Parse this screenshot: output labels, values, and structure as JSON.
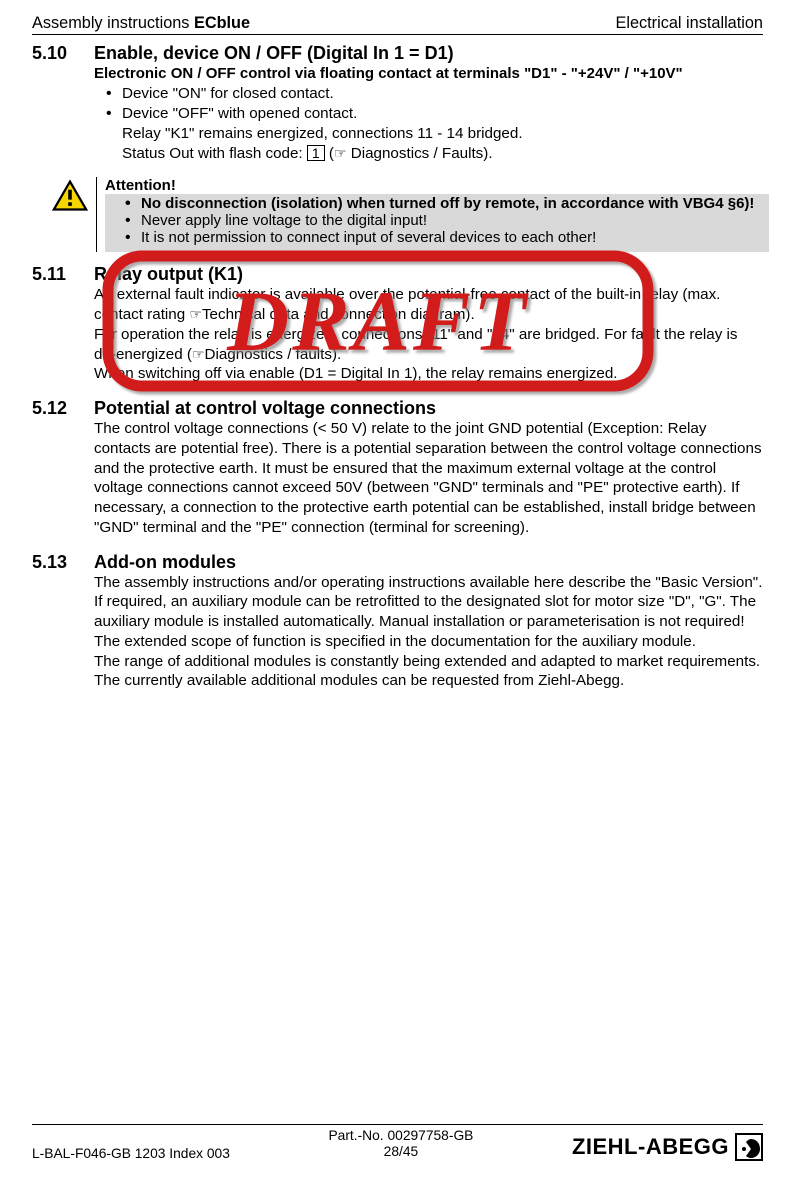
{
  "header": {
    "prefix": "Assembly instructions ",
    "product": "ECblue",
    "right": "Electrical installation"
  },
  "s510": {
    "num": "5.10",
    "title": "Enable, device ON / OFF (Digital In 1 = D1)",
    "subtitle": "Electronic ON / OFF control via floating contact at terminals \"D1\" - \"+24V\" / \"+10V\"",
    "b1": "Device \"ON\" for closed contact.",
    "b2": "Device \"OFF\" with opened contact.",
    "b2_sub1": "Relay \"K1\" remains energized, connections 11 - 14 bridged.",
    "b2_sub2_pre": "Status Out with flash code:  ",
    "b2_sub2_box": "1",
    "b2_sub2_post": " Diagnostics / Faults)."
  },
  "attention": {
    "title": "Attention!",
    "b1": "No disconnection (isolation) when turned off by remote, in accordance with VBG4 §6)!",
    "b2": "Never apply line voltage to the digital input!",
    "b3": "It is not permission to connect input of several devices to each other!"
  },
  "s511": {
    "num": "5.11",
    "title": "Relay output (K1)",
    "p1_pre": "An external fault indicator is available over the potential-free contact of the built-in relay (max. contact rating ",
    "p1_post": "Technical data and connection diagram).",
    "p2_pre": "For operation the relay is energized, connections \"11\" and \"14\" are bridged. For fault the relay is de-energized (",
    "p2_post": "Diagnostics / faults).",
    "p3": "When switching off via enable  (D1 = Digital In 1), the relay remains energized."
  },
  "s512": {
    "num": "5.12",
    "title": "Potential at control voltage connections",
    "p1": "The control voltage connections (< 50 V) relate to the joint GND potential (Exception: Relay contacts are potential free). There is a potential separation between the control voltage connections and the protective earth. It must be ensured that the maximum external voltage at the control voltage connections cannot exceed 50V (between \"GND\" terminals and \"PE\" protective earth). If necessary, a connection to the protective earth potential can be established, install bridge between \"GND\" terminal and the \"PE\" connection (terminal for screening)."
  },
  "s513": {
    "num": "5.13",
    "title": "Add-on modules",
    "p1": "The assembly instructions and/or operating instructions available here describe the \"Basic Version\".",
    "p2": "If required, an auxiliary module can be retrofitted to the designated slot for motor size \"D\", \"G\". The auxiliary module is installed automatically. Manual installation or parameter­isation is not required!",
    "p3": "The extended scope of function is specified in the documentation for the auxiliary module.",
    "p4": "The range of additional modules is constantly being extended and adapted to market requirements. The currently available additional modules can be requested from Ziehl-Abegg."
  },
  "footer": {
    "left": "L-BAL-F046-GB 1203 Index 003",
    "mid_top": "Part.-No. 00297758-GB",
    "mid_bot": "28/45",
    "brand": "ZIEHL-ABEGG"
  },
  "draft_label": "DRAFT"
}
